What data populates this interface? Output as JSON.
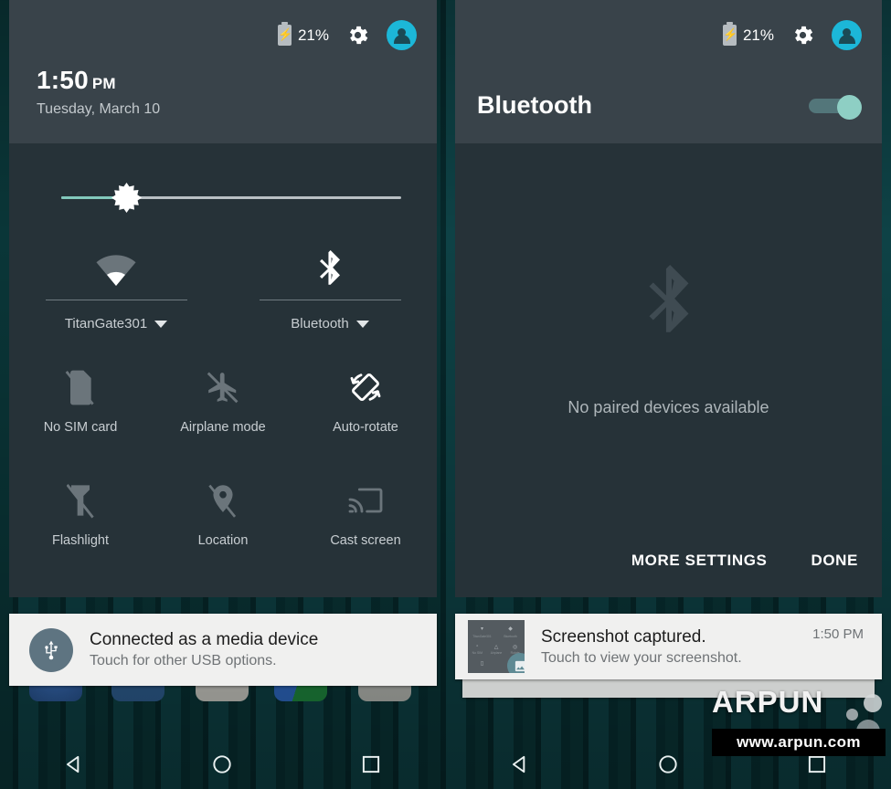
{
  "status_bar": {
    "battery_percent": "21%",
    "battery_icon": "battery-charging-icon",
    "settings_icon": "gear-icon",
    "avatar_icon": "user-avatar-icon"
  },
  "left_panel": {
    "clock": {
      "time": "1:50",
      "ampm": "PM",
      "date": "Tuesday, March 10"
    },
    "brightness": {
      "icon": "brightness-icon",
      "value_percent": 19
    },
    "big_tiles": [
      {
        "label": "TitanGate301",
        "icon": "wifi-icon",
        "has_caret": true,
        "state": "on"
      },
      {
        "label": "Bluetooth",
        "icon": "bluetooth-icon",
        "has_caret": true,
        "state": "on"
      }
    ],
    "small_tiles": [
      {
        "label": "No SIM card",
        "icon": "sim-card-off-icon",
        "state": "off"
      },
      {
        "label": "Airplane mode",
        "icon": "airplane-off-icon",
        "state": "off"
      },
      {
        "label": "Auto-rotate",
        "icon": "auto-rotate-icon",
        "state": "on"
      },
      {
        "label": "Flashlight",
        "icon": "flashlight-off-icon",
        "state": "off"
      },
      {
        "label": "Location",
        "icon": "location-off-icon",
        "state": "off"
      },
      {
        "label": "Cast screen",
        "icon": "cast-screen-icon",
        "state": "off"
      }
    ]
  },
  "right_panel": {
    "title": "Bluetooth",
    "toggle": {
      "icon": "toggle-switch-icon",
      "state": "on"
    },
    "empty_state": {
      "icon": "bluetooth-large-icon",
      "message": "No paired devices available"
    },
    "actions": [
      {
        "label": "MORE SETTINGS",
        "name": "more-settings-button"
      },
      {
        "label": "DONE",
        "name": "done-button"
      }
    ]
  },
  "notifications": {
    "left": {
      "icon": "usb-icon",
      "title": "Connected as a media device",
      "subtitle": "Touch for other USB options."
    },
    "right": {
      "icon": "screenshot-thumbnail",
      "badge_icon": "image-icon",
      "title": "Screenshot captured.",
      "subtitle": "Touch to view your screenshot.",
      "time": "1:50 PM"
    }
  },
  "nav_bar": {
    "back": "back-triangle-icon",
    "home": "home-circle-icon",
    "recents": "recents-square-icon"
  },
  "watermark": {
    "brand": "ARPUN",
    "url": "www.arpun.com"
  },
  "colors": {
    "panel_bg": "#263238",
    "header_bg": "#39434a",
    "accent_cyan": "#1cb7d8",
    "accent_teal": "#82c9bc",
    "notif_bg": "#f0f0ef",
    "wallpaper": "#0a3638"
  }
}
